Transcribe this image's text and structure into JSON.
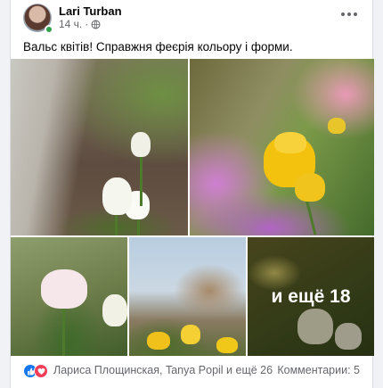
{
  "post": {
    "author": "Lari Turban",
    "time": "14 ч.",
    "privacy_icon": "globe-icon",
    "caption": "Вальс квітів! Справжня феєрія кольору і форми.",
    "photos_more_label": "и ещё 18",
    "reactions": [
      "like-icon",
      "love-icon"
    ],
    "reactors_text": "Лариса Площинская, Tanya Popil и ещё 26",
    "comments_text": "Комментарии: 5",
    "colors": {
      "like": "#1877f2",
      "love": "#f33e58",
      "online": "#31a24c",
      "secondary_text": "#65676b"
    }
  }
}
